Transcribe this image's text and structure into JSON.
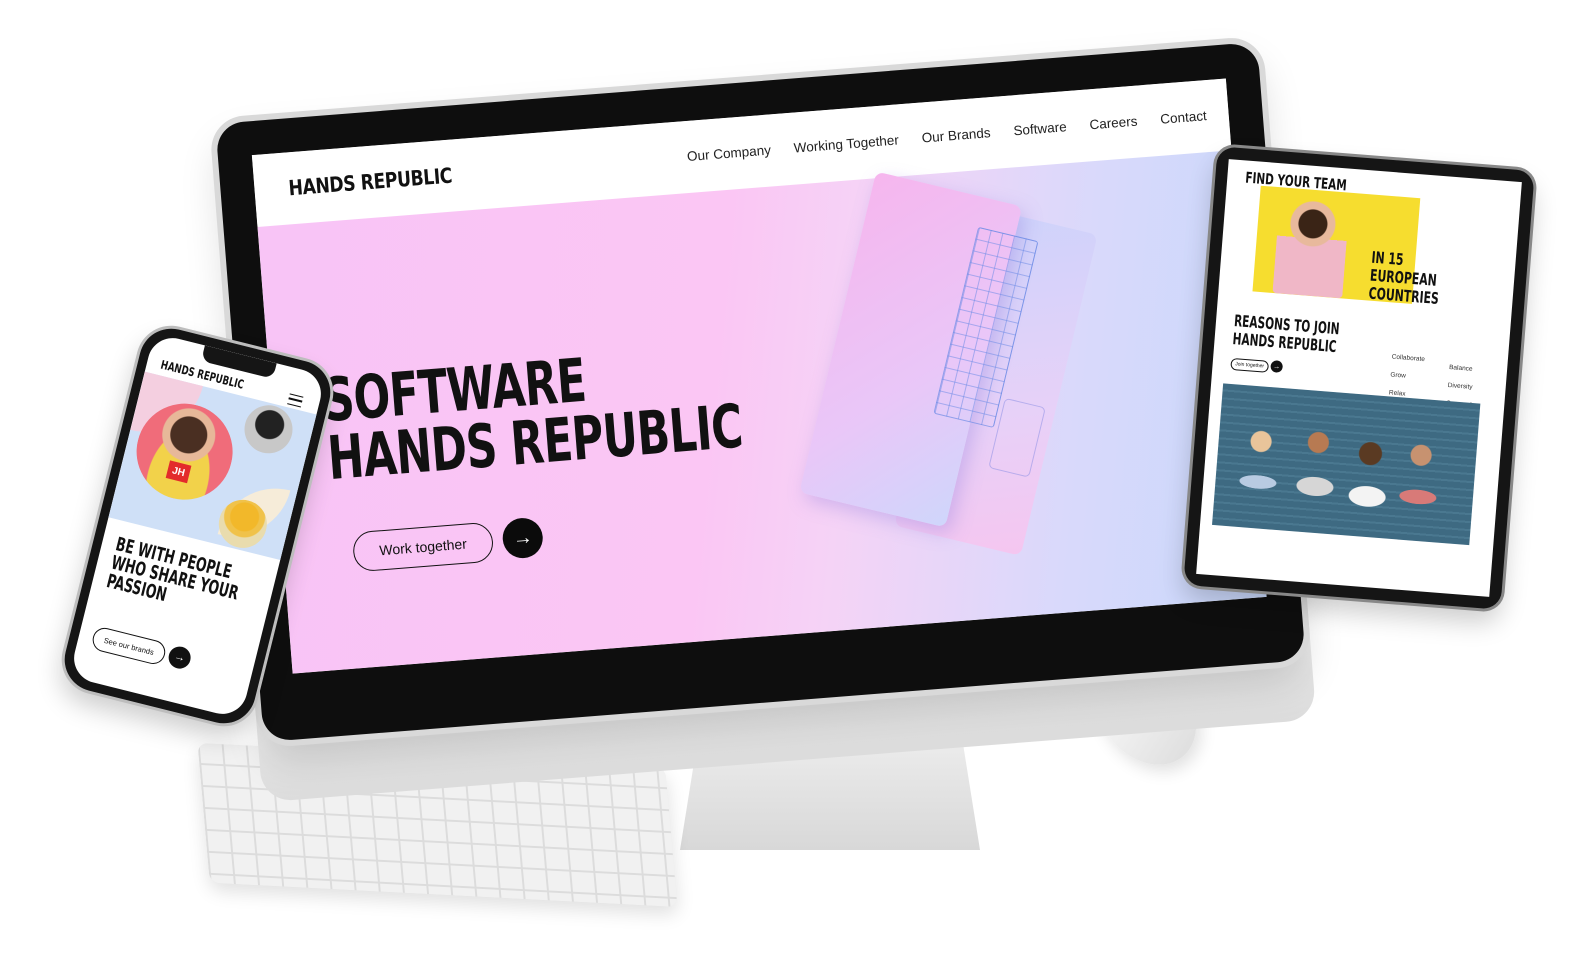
{
  "desktop": {
    "logo": "HANDS REPUBLIC",
    "nav": [
      "Our Company",
      "Working Together",
      "Our Brands",
      "Software",
      "Careers",
      "Contact"
    ],
    "hero_title_line1": "SOFTWARE",
    "hero_title_line2": "HANDS REPUBLIC",
    "cta_label": "Work together",
    "arrow_icon": "→"
  },
  "tablet": {
    "title": "FIND YOUR TEAM",
    "countries_line1": "IN 15 EUROPEAN",
    "countries_line2": "COUNTRIES",
    "reasons_line1": "REASONS TO JOIN",
    "reasons_line2": "HANDS REPUBLIC",
    "cta_label": "Join together",
    "arrow_icon": "→",
    "list_left": [
      "Collaborate",
      "Grow",
      "Relax"
    ],
    "list_right": [
      "Balance",
      "Diversity",
      "Succeed"
    ]
  },
  "phone": {
    "logo": "HANDS REPUBLIC",
    "badge": "JH",
    "headline_line1": "BE WITH PEOPLE",
    "headline_line2": "WHO SHARE YOUR",
    "headline_line3": "PASSION",
    "cta_label": "See our brands",
    "arrow_icon": "→"
  },
  "colors": {
    "hero_pink": "#f8c4f6",
    "hero_blue": "#c8d8fb",
    "tablet_yellow": "#f6dd2f",
    "button_dark": "#0b0b0b"
  }
}
